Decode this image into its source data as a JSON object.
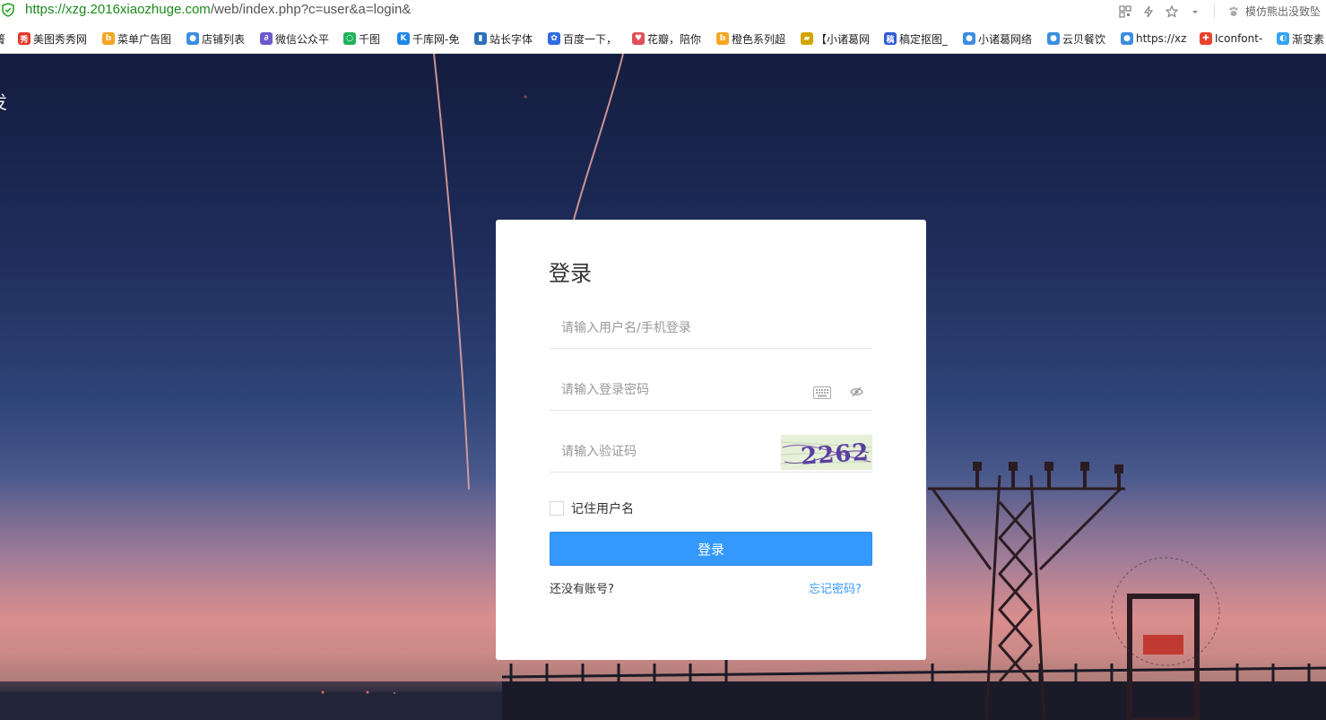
{
  "browser": {
    "url_scheme": "https://",
    "url_host": "xzg.2016xiaozhuge.com",
    "url_path": "/web/index.php?c=user&a=login&",
    "news_ticker": "模仿熊出没致坠"
  },
  "bookmarks": [
    {
      "label": "美图秀秀网",
      "icon": "meitu-icon",
      "color": "#e23b2e"
    },
    {
      "label": "菜单广告图",
      "icon": "bing-icon",
      "color": "#f5a623"
    },
    {
      "label": "店铺列表",
      "icon": "wechat-icon",
      "color": "#3b8de0"
    },
    {
      "label": "微信公众平",
      "icon": "link-icon",
      "color": "#6a5acd"
    },
    {
      "label": "千图",
      "icon": "qiantu-icon",
      "color": "#1fb25a"
    },
    {
      "label": "千库网-免",
      "icon": "qianku-icon",
      "color": "#1e88e5"
    },
    {
      "label": "站长字体",
      "icon": "font-icon",
      "color": "#2d6fb8"
    },
    {
      "label": "百度一下，",
      "icon": "baidu-icon",
      "color": "#2f6be0"
    },
    {
      "label": "花瓣，陪你",
      "icon": "huaban-icon",
      "color": "#e0505a"
    },
    {
      "label": "橙色系列超",
      "icon": "bing-icon",
      "color": "#f5a623"
    },
    {
      "label": "【小诸葛网",
      "icon": "shield-badge-icon",
      "color": "#d4a400"
    },
    {
      "label": "稿定抠图_",
      "icon": "gaoding-icon",
      "color": "#2f5bd8"
    },
    {
      "label": "小诸葛网络",
      "icon": "wechat-icon",
      "color": "#3b8de0"
    },
    {
      "label": "云贝餐饮",
      "icon": "wechat-icon",
      "color": "#3b8de0"
    },
    {
      "label": "https://xz",
      "icon": "wechat-icon",
      "color": "#3b8de0"
    },
    {
      "label": "Iconfont-",
      "icon": "iconfont-icon",
      "color": "#e8432e"
    },
    {
      "label": "渐变素",
      "icon": "gradient-icon",
      "color": "#36a3f0"
    }
  ],
  "page": {
    "brand_fragment": "发"
  },
  "login": {
    "title": "登录",
    "username_placeholder": "请输入用户名/手机登录",
    "password_placeholder": "请输入登录密码",
    "captcha_placeholder": "请输入验证码",
    "captcha_text": "2262",
    "remember_label": "记住用户名",
    "submit_label": "登录",
    "register_text": "还没有账号?",
    "forgot_text": "忘记密码?",
    "accent_color": "#3399ff"
  }
}
